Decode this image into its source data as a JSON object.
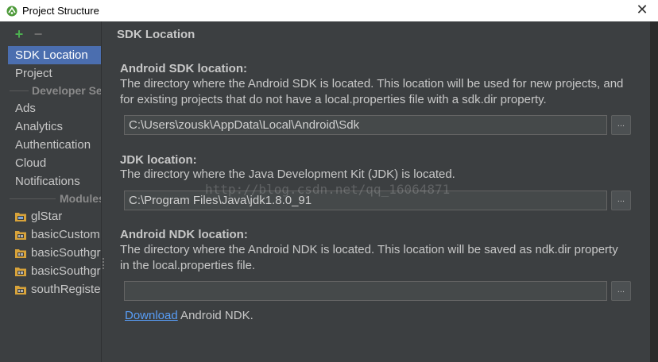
{
  "window": {
    "title": "Project Structure",
    "close_glyph": "✕"
  },
  "toolbar": {
    "add_glyph": "+",
    "remove_glyph": "−"
  },
  "sidebar": {
    "items": [
      {
        "label": "SDK Location",
        "selected": true
      },
      {
        "label": "Project",
        "selected": false
      }
    ],
    "developer_header": "Developer Services",
    "services": [
      "Ads",
      "Analytics",
      "Authentication",
      "Cloud",
      "Notifications"
    ],
    "modules_header": "Modules",
    "modules": [
      "glStar",
      "basicCustom",
      "basicSouthgr",
      "basicSouthgr",
      "southRegiste"
    ]
  },
  "content": {
    "page_title": "SDK Location",
    "sdk": {
      "title": "Android SDK location:",
      "description": "The directory where the Android SDK is located. This location will be used for new projects, and for existing projects that do not have a local.properties file with a sdk.dir property.",
      "value": "C:\\Users\\zousk\\AppData\\Local\\Android\\Sdk",
      "browse_label": "..."
    },
    "jdk": {
      "title": "JDK location:",
      "description": "The directory where the Java Development Kit (JDK) is located.",
      "value": "C:\\Program Files\\Java\\jdk1.8.0_91",
      "browse_label": "..."
    },
    "ndk": {
      "title": "Android NDK location:",
      "description": "The directory where the Android NDK is located. This location will be saved as ndk.dir property in the local.properties file.",
      "value": "",
      "browse_label": "..."
    },
    "download_link": "Download",
    "download_suffix": " Android NDK."
  },
  "watermark": "http://blog.csdn.net/qq_16064871",
  "colors": {
    "background": "#3c3f41",
    "selection": "#4b6eaf",
    "link": "#589df6",
    "add_icon": "#4caf50",
    "folder_icon": "#d8a33a"
  }
}
